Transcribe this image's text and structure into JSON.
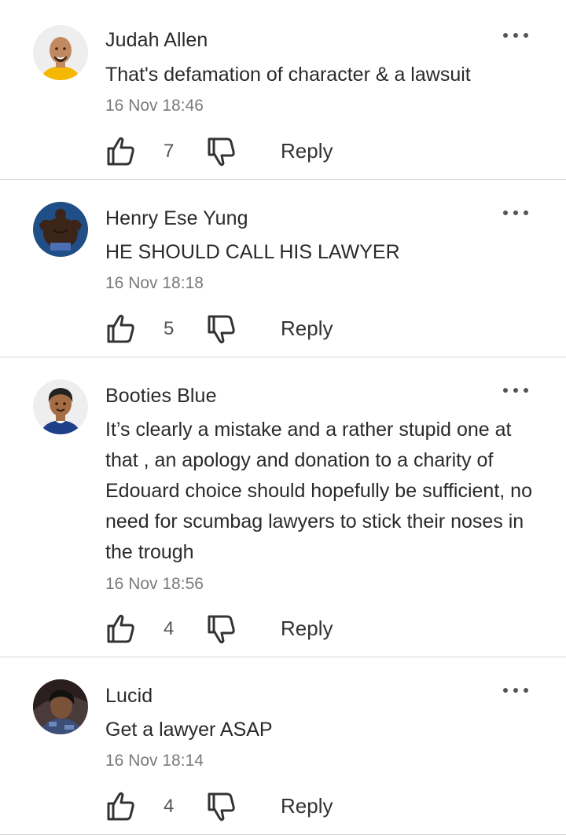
{
  "comments": [
    {
      "author": "Judah Allen",
      "text": "That's defamation of character & a lawsuit",
      "time": "16 Nov 18:46",
      "likes": "7",
      "reply_label": "Reply",
      "avatar_icon": "bald-man-avatar"
    },
    {
      "author": "Henry Ese Yung",
      "text": "HE SHOULD CALL HIS LAWYER",
      "time": "16 Nov 18:18",
      "likes": "5",
      "reply_label": "Reply",
      "avatar_icon": "bodybuilder-photo-avatar"
    },
    {
      "author": "Booties Blue",
      "text": "It’s clearly a mistake and a rather stupid one at that , an apology and donation to a charity of Edouard  choice should hopefully be sufficient, no need for scumbag lawyers to stick their noses in the trough",
      "time": "16 Nov 18:56",
      "likes": "4",
      "reply_label": "Reply",
      "avatar_icon": "man-avatar"
    },
    {
      "author": "Lucid",
      "text": "Get a lawyer ASAP",
      "time": "16 Nov 18:14",
      "likes": "4",
      "reply_label": "Reply",
      "avatar_icon": "photo-avatar"
    }
  ]
}
